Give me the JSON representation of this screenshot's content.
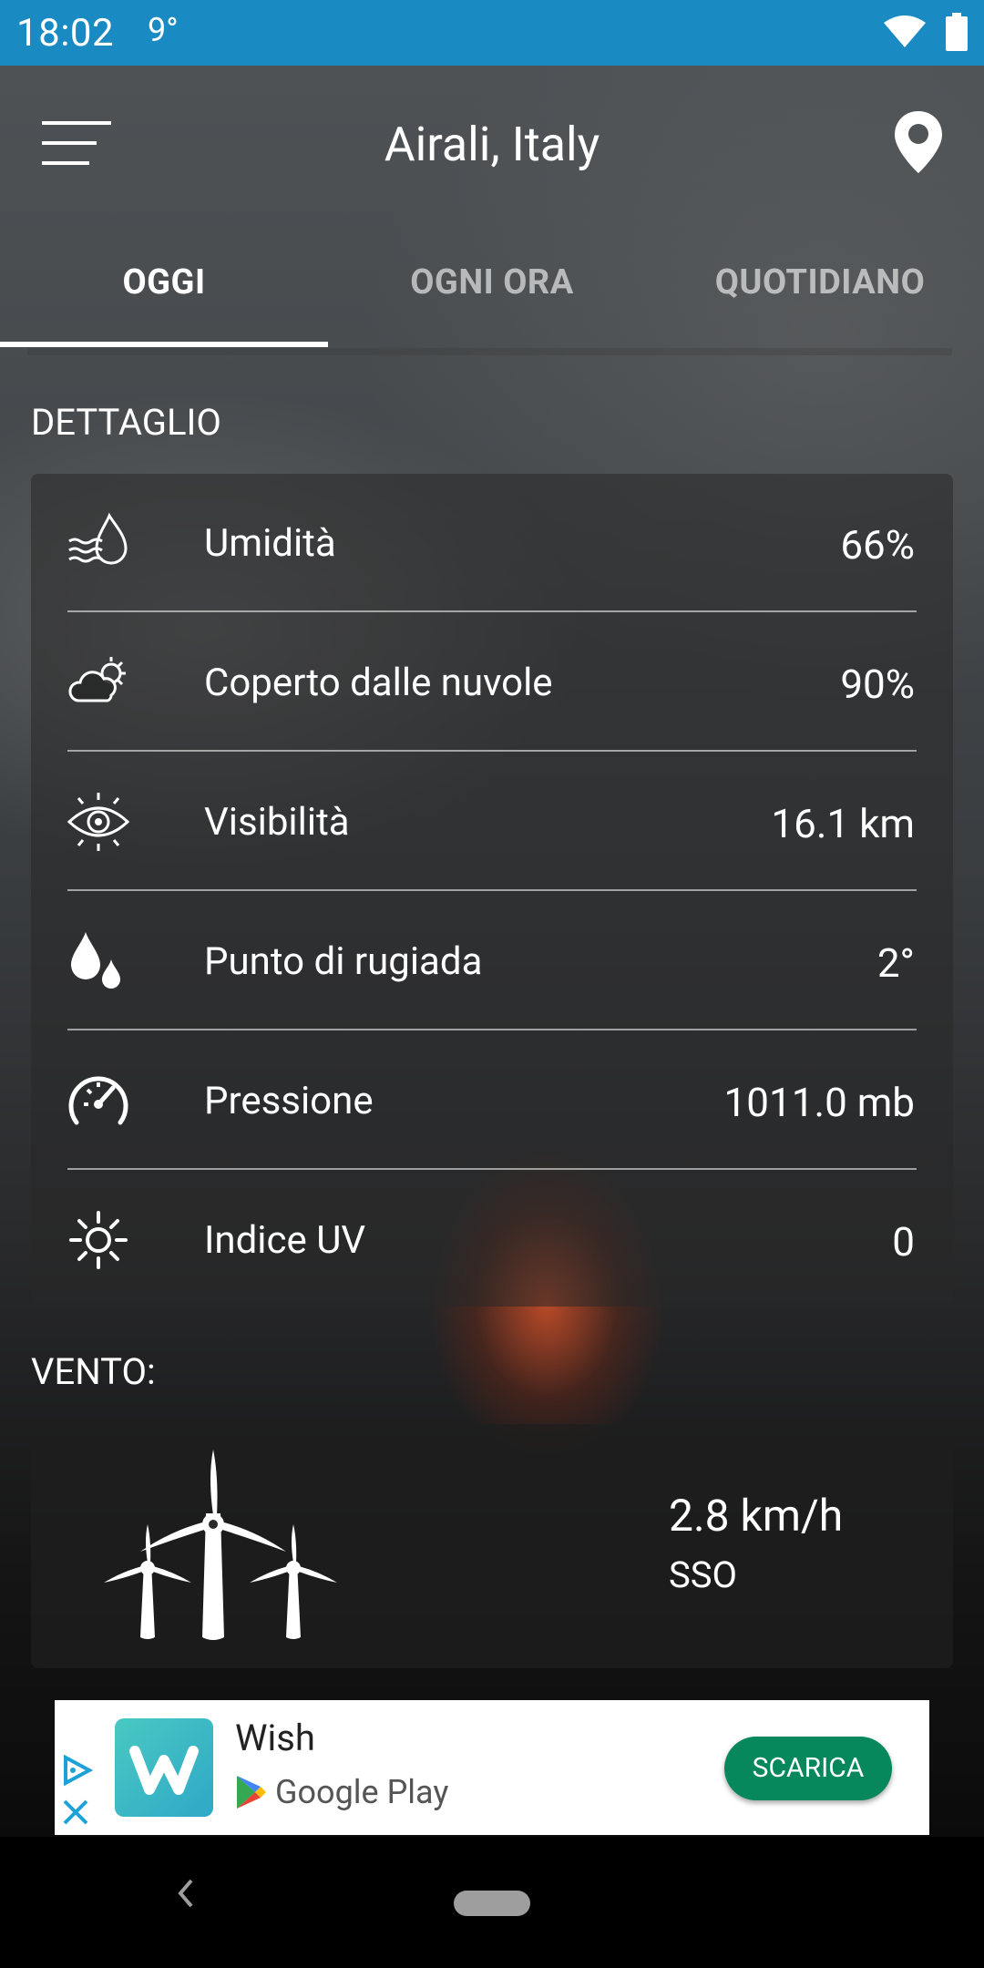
{
  "status_bar": {
    "time": "18:02",
    "temperature": "9°"
  },
  "header": {
    "location": "Airali, Italy"
  },
  "tabs": [
    {
      "label": "OGGI",
      "active": true
    },
    {
      "label": "OGNI ORA",
      "active": false
    },
    {
      "label": "QUOTIDIANO",
      "active": false
    }
  ],
  "details": {
    "section_title": "DETTAGLIO",
    "rows": [
      {
        "icon": "humidity-icon",
        "label": "Umidità",
        "value": "66%"
      },
      {
        "icon": "cloud-cover-icon",
        "label": "Coperto dalle nuvole",
        "value": "90%"
      },
      {
        "icon": "visibility-icon",
        "label": "Visibilità",
        "value": "16.1 km"
      },
      {
        "icon": "dew-point-icon",
        "label": "Punto di rugiada",
        "value": "2°"
      },
      {
        "icon": "pressure-icon",
        "label": "Pressione",
        "value": "1011.0 mb"
      },
      {
        "icon": "uv-index-icon",
        "label": "Indice UV",
        "value": "0"
      }
    ]
  },
  "wind": {
    "section_title": "VENTO:",
    "speed": "2.8 km/h",
    "direction": "SSO"
  },
  "ad": {
    "app_name": "Wish",
    "store": "Google Play",
    "button": "SCARICA"
  },
  "colors": {
    "status_bar": "#1a8bc2",
    "ad_button": "#07875c"
  }
}
